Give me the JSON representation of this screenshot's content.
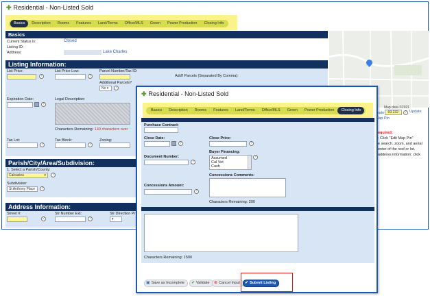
{
  "back": {
    "title": "Residential - Non-Listed Sold",
    "tabs": [
      "Basics",
      "Description",
      "Rooms",
      "Features",
      "Land/Terms",
      "Office/MLS",
      "Green",
      "Power Production",
      "Closing Info"
    ],
    "active_tab": "Basics",
    "basics": {
      "header": "Basics",
      "current_status_label": "Current Status is:",
      "current_status_value": "Closed",
      "listing_id_label": "Listing ID:",
      "address_label": "Address:",
      "address_city": "Lake Charles"
    },
    "listing_info": {
      "header": "Listing Information:",
      "list_price_label": "List Price:",
      "list_price_low_label": "List Price Low:",
      "parcel_label": "Parcel Number/Tax ID:",
      "addl_parcels_label": "Add'l Parcels (Separated By Comma):",
      "additional_parcels_label": "Additional Parcels?",
      "additional_parcels_value": "No",
      "expiration_label": "Expiration Date:",
      "legal_label": "Legal Description:",
      "chars_label": "Characters Remaining:",
      "chars_value": "140 characters over",
      "tax_lot_label": "Tax Lot:",
      "tax_block_label": "Tax Block:",
      "zoning_label": "Zoning:"
    },
    "parish": {
      "header": "Parish/City/Area/Subdivision:",
      "select_parish_label": "1. Select a Parish/County:",
      "parish_value": "Calcasieu",
      "subdivision_label": "Subdivision:",
      "subdivision_value": "St Anthony Place"
    },
    "address_info": {
      "header": "Address Information:",
      "street_label": "Street #:",
      "str_number_ext_label": "Str Number Ext:",
      "str_direction_label": "Str Direction Pr"
    },
    "map_panel": {
      "map_credit": "Map data ©2021",
      "longitude_label": "ude",
      "longitude_value": "-93.232",
      "update_link": "Update",
      "map_pin_link": "lap Pin",
      "required_title": "equired:",
      "note_lines": [
        ": Click \"Edit Map Pin\"",
        "e search, zoom, and aerial",
        "enter of the roof or lot.",
        "address information; click"
      ]
    }
  },
  "front": {
    "title": "Residential - Non-Listed Sold",
    "tabs": [
      "Basics",
      "Description",
      "Rooms",
      "Features",
      "Land/Terms",
      "Office/MLS",
      "Green",
      "Power Production",
      "Closing Info"
    ],
    "active_tab": "Closing Info",
    "closing": {
      "purchase_contract_label": "Purchase Contract:",
      "close_date_label": "Close Date:",
      "close_price_label": "Close Price:",
      "buyer_financing_label": "Buyer Financing:",
      "financing_options": [
        "Assumed",
        "Cal Vet",
        "Cash"
      ],
      "document_number_label": "Document Number:",
      "concessions_comments_label": "Concessions Comments:",
      "concessions_amount_label": "Concessions Amount:",
      "concessions_chars": "Characters Remaining: 200",
      "private_chars": "Characters Remaining: 1500"
    },
    "buttons": {
      "save_incomplete": "Save as Incomplete",
      "validate": "Validate",
      "cancel": "Cancel Input",
      "submit": "Submit Listing"
    }
  },
  "colors": {
    "header_navy": "#11305e",
    "panel_blue": "#d8e5f4",
    "highlight_yellow": "#fbf38a",
    "accent_blue": "#1c57b0",
    "red": "#e02020"
  }
}
